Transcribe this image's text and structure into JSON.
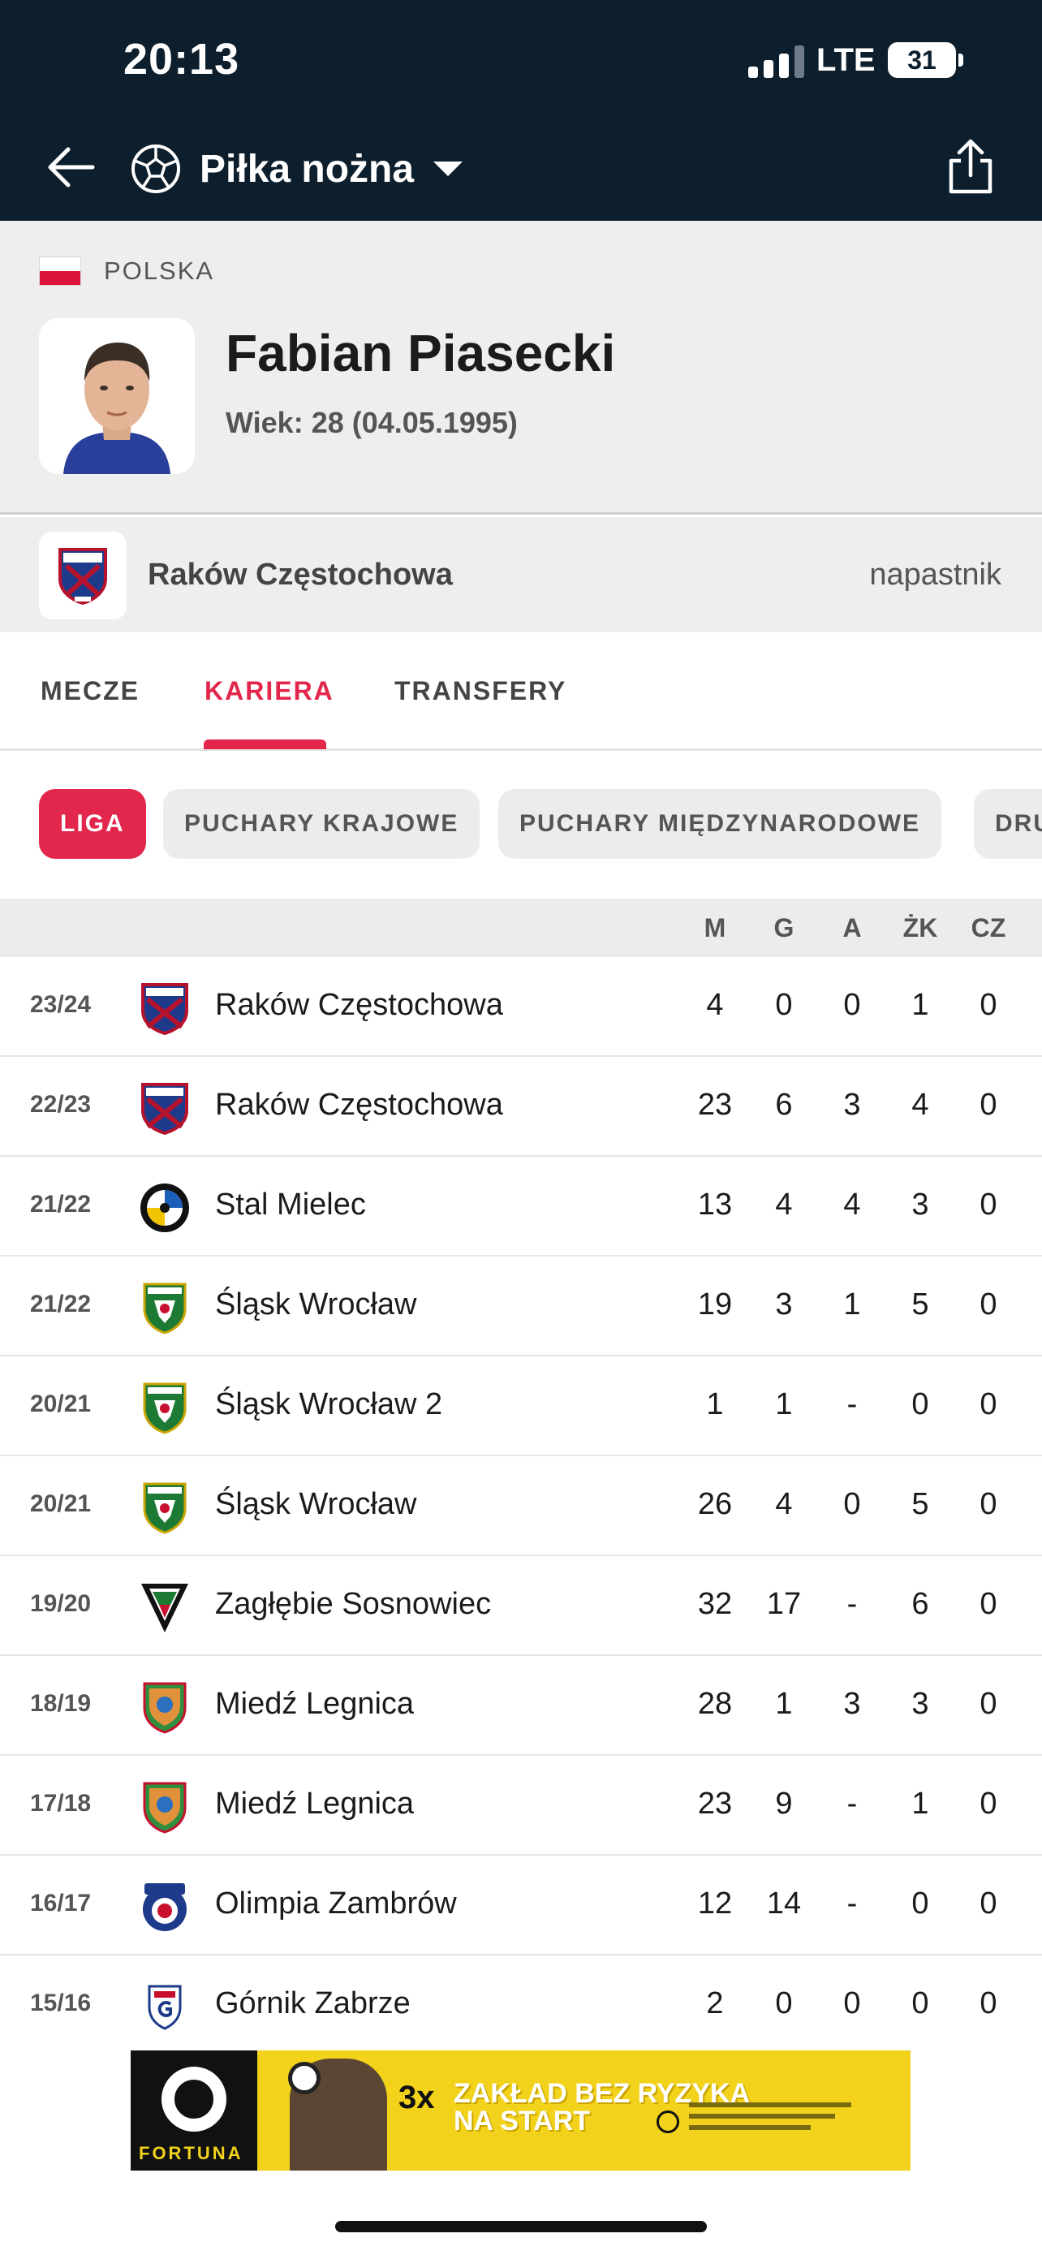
{
  "status_bar": {
    "time": "20:13",
    "network": "LTE",
    "battery": "31"
  },
  "header": {
    "sport_title": "Piłka nożna"
  },
  "player": {
    "country": "POLSKA",
    "name": "Fabian Piasecki",
    "age": "Wiek: 28 (04.05.1995)",
    "team": "Raków Częstochowa",
    "position": "napastnik"
  },
  "tabs": [
    {
      "label": "MECZE"
    },
    {
      "label": "KARIERA",
      "active": true
    },
    {
      "label": "TRANSFERY"
    }
  ],
  "filters": [
    {
      "label": "LIGA",
      "active": true
    },
    {
      "label": "PUCHARY KRAJOWE"
    },
    {
      "label": "PUCHARY MIĘDZYNARODOWE"
    },
    {
      "label": "DRU"
    }
  ],
  "table": {
    "columns": [
      "M",
      "G",
      "A",
      "ŻK",
      "CZ"
    ],
    "rows": [
      {
        "season": "23/24",
        "club": "Raków Częstochowa",
        "logo": "rakow",
        "m": "4",
        "g": "0",
        "a": "0",
        "zk": "1",
        "cz": "0"
      },
      {
        "season": "22/23",
        "club": "Raków Częstochowa",
        "logo": "rakow",
        "m": "23",
        "g": "6",
        "a": "3",
        "zk": "4",
        "cz": "0"
      },
      {
        "season": "21/22",
        "club": "Stal Mielec",
        "logo": "stal",
        "m": "13",
        "g": "4",
        "a": "4",
        "zk": "3",
        "cz": "0"
      },
      {
        "season": "21/22",
        "club": "Śląsk Wrocław",
        "logo": "slask",
        "m": "19",
        "g": "3",
        "a": "1",
        "zk": "5",
        "cz": "0"
      },
      {
        "season": "20/21",
        "club": "Śląsk Wrocław 2",
        "logo": "slask",
        "m": "1",
        "g": "1",
        "a": "-",
        "zk": "0",
        "cz": "0"
      },
      {
        "season": "20/21",
        "club": "Śląsk Wrocław",
        "logo": "slask",
        "m": "26",
        "g": "4",
        "a": "0",
        "zk": "5",
        "cz": "0"
      },
      {
        "season": "19/20",
        "club": "Zagłębie Sosnowiec",
        "logo": "zaglebie",
        "m": "32",
        "g": "17",
        "a": "-",
        "zk": "6",
        "cz": "0"
      },
      {
        "season": "18/19",
        "club": "Miedź Legnica",
        "logo": "miedz",
        "m": "28",
        "g": "1",
        "a": "3",
        "zk": "3",
        "cz": "0"
      },
      {
        "season": "17/18",
        "club": "Miedź Legnica",
        "logo": "miedz",
        "m": "23",
        "g": "9",
        "a": "-",
        "zk": "1",
        "cz": "0"
      },
      {
        "season": "16/17",
        "club": "Olimpia Zambrów",
        "logo": "olimpia",
        "m": "12",
        "g": "14",
        "a": "-",
        "zk": "0",
        "cz": "0"
      },
      {
        "season": "15/16",
        "club": "Górnik Zabrze",
        "logo": "gornik",
        "m": "2",
        "g": "0",
        "a": "0",
        "zk": "0",
        "cz": "0"
      }
    ]
  },
  "ad": {
    "brand": "FORTUNA",
    "multiplier": "3x",
    "line1": "Zakład bez ryzyka",
    "line2": "na start"
  },
  "colors": {
    "accent": "#e3264b",
    "topbar": "#0d1f2d",
    "header_bg": "#eeeeee"
  }
}
